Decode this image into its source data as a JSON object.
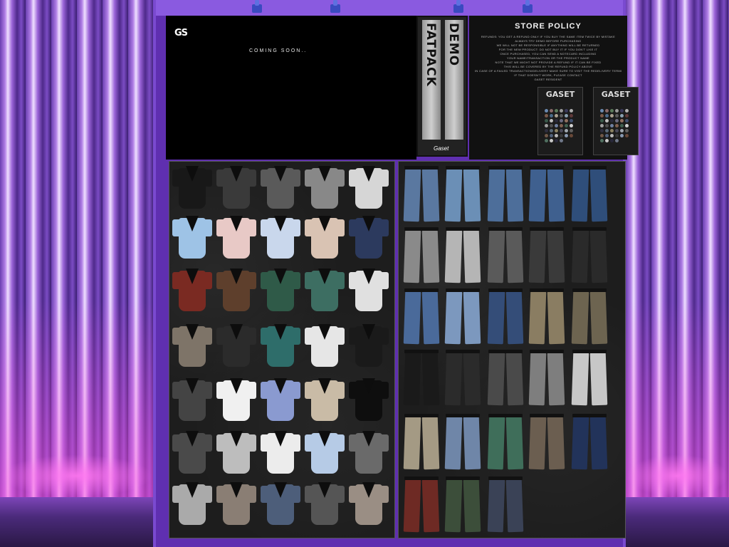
{
  "scene": {
    "title": ""
  },
  "coming_soon": {
    "logo_text": "GS",
    "message": "COMING SOON.."
  },
  "demo_box": {
    "word_top": "DEMO",
    "word_left": "FATPACK",
    "word_right": "FATPACK",
    "signature": "Gaset"
  },
  "policy": {
    "title": "STORE POLICY",
    "lines": [
      "REFUNDS: YOU GET A REFUND ONLY IF YOU BUY THE SAME ITEM TWICE BY MISTAKE",
      "ALWAYS TRY DEMO BEFORE PURCHASING",
      "WE WILL NOT BE RESPONSIBLE IF ANYTHING WILL BE RETURNED",
      "FOR THE NEW PRODUCT: DO NOT BUY IT IF YOU DON'T LIKE IT",
      "ONCE PURCHASED, YOU CAN SEND A NOTECARD INCLUDING",
      "YOUR NAME/TRANSACTION OR THE PRODUCT NAME",
      "NOTE THAT WE MIGHT NOT PROVIDE A REFUND IF IT CAN BE FIXED",
      "THIS WILL BE COVERED BY THE REFUND POLICY ABOVE",
      "",
      "IN CASE OF A FAILED TRANSACTION/DELIVERY MAKE SURE TO VISIT THE REDELIVERY TERMINAL FIRST",
      "IF THAT DOESN'T WORK, PLEASE CONTACT",
      "GASET RESIDENT"
    ],
    "cards": [
      {
        "brand": "GASET"
      },
      {
        "brand": "GASET"
      }
    ]
  },
  "shirt_colors": [
    [
      "#181818",
      "#3a3a3a",
      "#5a5a5a",
      "#888888",
      "#d6d6d6"
    ],
    [
      "#9ec3e6",
      "#e8c9c6",
      "#c9d7ec",
      "#d9c3b3",
      "#2c3a5e"
    ],
    [
      "#7a2a22",
      "#5e3f2c",
      "#2f5a48",
      "#3d6e62",
      "#e0e0e0"
    ],
    [
      "#7e7468",
      "#2b2b2b",
      "#2e6d6a",
      "#e6e6e6",
      "#1a1a1a"
    ],
    [
      "#444444",
      "#f0f0f0",
      "#8a9ad0",
      "#c9bba6",
      "#0e0e0e"
    ],
    [
      "#4a4a4a",
      "#bdbdbd",
      "#ececec",
      "#b6cbe6",
      "#6a6a6a"
    ],
    [
      "#aaaaaa",
      "#8a7e74",
      "#4d5e7a",
      "#555555",
      "#9a8e84"
    ]
  ],
  "pant_colors": [
    [
      "#5a78a0",
      "#6b8fb6",
      "#4d6e9a",
      "#3f608f",
      "#2f4e7a"
    ],
    [
      "#8a8a8a",
      "#b5b5b5",
      "#5a5a5a",
      "#3a3a3a",
      "#2a2a2a"
    ],
    [
      "#4a6a9a",
      "#7c98be",
      "#344d78",
      "#8a7d62",
      "#6d6450"
    ],
    [
      "#1a1a1a",
      "#2b2b2b",
      "#4a4a4a",
      "#7e7e7e",
      "#c7c7c7"
    ],
    [
      "#a49a84",
      "#6f86a8",
      "#3f6e5a",
      "#6b5e50",
      "#22335a"
    ],
    [
      "#6e2a24",
      "#3c4e3a",
      "#3a4256"
    ]
  ],
  "swatch_dots": [
    "#6a8ab0",
    "#8a6a6a",
    "#5a7a5a",
    "#9a9a9a",
    "#3a3a5a",
    "#b0b0b0",
    "#7a5a4a",
    "#4a6a8a",
    "#aaa090",
    "#5a5a5a",
    "#8aa0b0",
    "#603a3a",
    "#3a5a4a",
    "#c0c0c0",
    "#2a2a3a",
    "#6a6a80",
    "#907060",
    "#405070",
    "#a0a0a0",
    "#505050",
    "#7080a0",
    "#806050",
    "#406050",
    "#d0d0d0",
    "#303040",
    "#5a6a7a",
    "#8a8060",
    "#4a4a5a",
    "#a0a8b0",
    "#606060",
    "#705848",
    "#50607a",
    "#b8b8b8",
    "#3a3a3a",
    "#8898b0",
    "#684838",
    "#507060",
    "#c8c8c8",
    "#28283a",
    "#70788a"
  ]
}
